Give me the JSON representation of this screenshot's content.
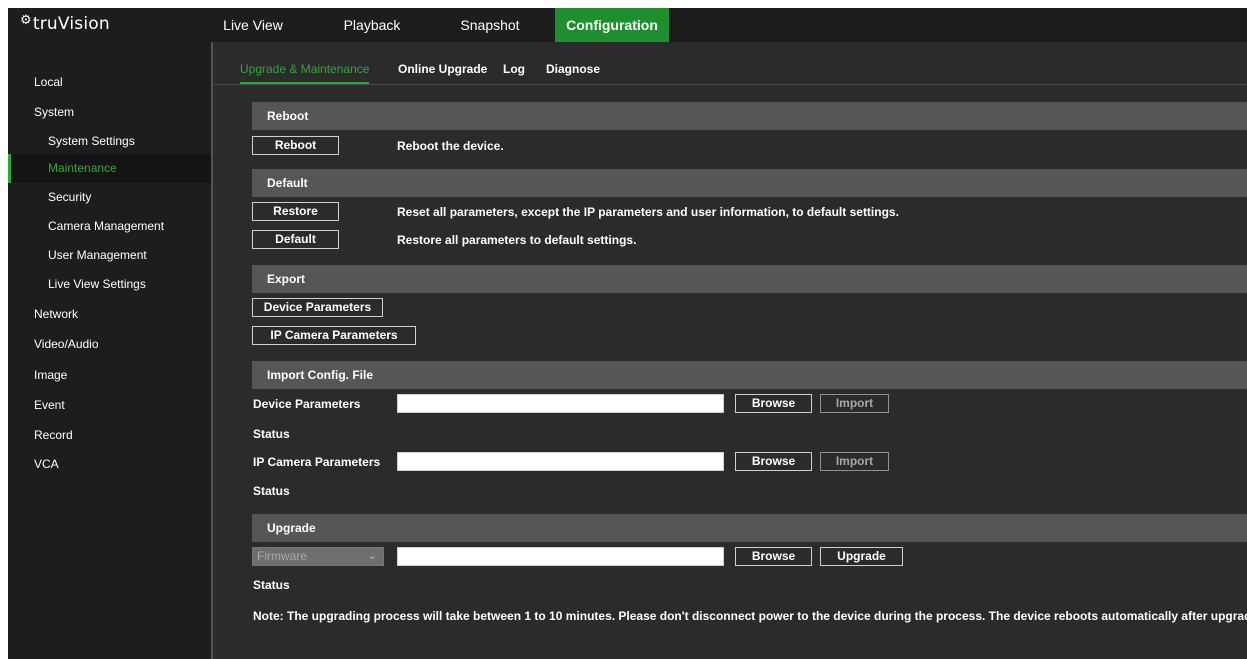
{
  "brand": {
    "logo_text": "truVision"
  },
  "nav": {
    "tabs": [
      {
        "label": "Live View"
      },
      {
        "label": "Playback"
      },
      {
        "label": "Snapshot"
      },
      {
        "label": "Configuration"
      }
    ],
    "active": "Configuration"
  },
  "sidebar": {
    "items": [
      {
        "label": "Local"
      },
      {
        "label": "System"
      },
      {
        "label": "System Settings"
      },
      {
        "label": "Maintenance"
      },
      {
        "label": "Security"
      },
      {
        "label": "Camera Management"
      },
      {
        "label": "User Management"
      },
      {
        "label": "Live View Settings"
      },
      {
        "label": "Network"
      },
      {
        "label": "Video/Audio"
      },
      {
        "label": "Image"
      },
      {
        "label": "Event"
      },
      {
        "label": "Record"
      },
      {
        "label": "VCA"
      }
    ],
    "active": "Maintenance"
  },
  "subtabs": {
    "items": [
      {
        "label": "Upgrade & Maintenance"
      },
      {
        "label": "Online Upgrade"
      },
      {
        "label": "Log"
      },
      {
        "label": "Diagnose"
      }
    ],
    "active": "Upgrade & Maintenance"
  },
  "reboot": {
    "title": "Reboot",
    "button": "Reboot",
    "description": "Reboot the device."
  },
  "default": {
    "title": "Default",
    "restore_button": "Restore",
    "restore_description": "Reset all parameters, except the IP parameters and user information, to default settings.",
    "default_button": "Default",
    "default_description": "Restore all parameters to default settings."
  },
  "export": {
    "title": "Export",
    "device_button": "Device Parameters",
    "ipcam_button": "IP Camera Parameters"
  },
  "import": {
    "title": "Import Config. File",
    "device_label": "Device Parameters",
    "device_value": "",
    "browse_label": "Browse",
    "import_label": "Import",
    "status_label": "Status",
    "ipcam_label": "IP Camera Parameters",
    "ipcam_value": ""
  },
  "upgrade": {
    "title": "Upgrade",
    "type_selected": "Firmware",
    "file_value": "",
    "browse_label": "Browse",
    "upgrade_label": "Upgrade",
    "status_label": "Status",
    "note": "Note: The upgrading process will take between 1 to 10 minutes. Please don't disconnect power to the device during the process. The device reboots automatically after upgrading."
  },
  "colors": {
    "accent": "#2fa83a",
    "active_tab_bg": "#1e8f2e",
    "section_bg": "#565656",
    "panel_bg": "#2b2b2b",
    "sidebar_bg": "#1d1d1d"
  }
}
